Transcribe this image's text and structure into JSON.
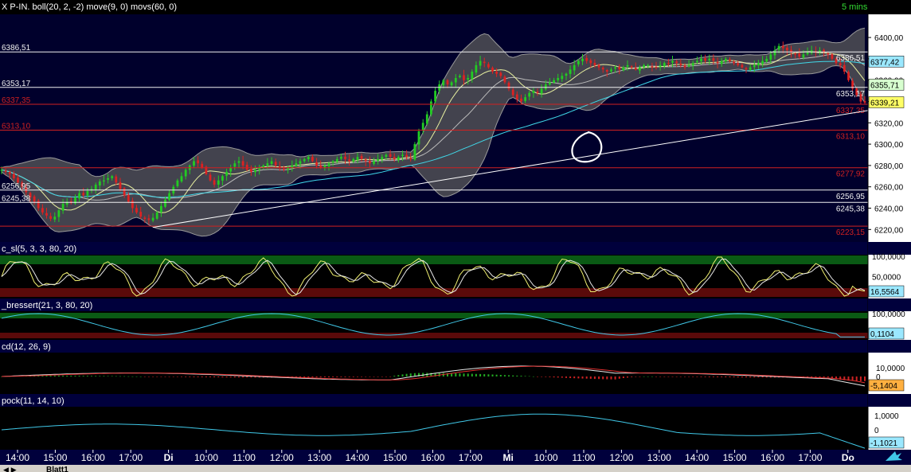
{
  "header": {
    "main_label": "X P-IN. boll(20, 2, -2) move(9, 0) movs(60, 0)",
    "timeframe": "5 mins"
  },
  "panes": {
    "stoch_label": "c_sl(5, 3, 3, 80, 20)",
    "bressert_label": "_bressert(21, 3, 80, 20)",
    "macd_label": "cd(12, 26, 9)",
    "coppock_label": "pock(11, 14, 10)"
  },
  "chart_data": [
    {
      "type": "candlestick",
      "title": "X P-IN. boll(20, 2, -2) move(9, 0) movs(60, 0)",
      "ylim": [
        6215,
        6412
      ],
      "yticks": [
        "6400,00",
        "6380,00",
        "6360,00",
        "6340,00",
        "6320,00",
        "6300,00",
        "6280,00",
        "6260,00",
        "6240,00",
        "6220,00"
      ],
      "grid": false,
      "x_tick_labels": [
        "14:00",
        "15:00",
        "16:00",
        "17:00",
        "Di",
        "10:00",
        "11:00",
        "12:00",
        "13:00",
        "14:00",
        "15:00",
        "16:00",
        "17:00",
        "Mi",
        "10:00",
        "11:00",
        "12:00",
        "13:00",
        "14:00",
        "15:00",
        "16:00",
        "17:00",
        "Do"
      ],
      "price_badges": [
        {
          "label": "6377,42",
          "value": 6377.42,
          "color": "#9be8ff"
        },
        {
          "label": "6355,71",
          "value": 6355.71,
          "color": "#d7ffcf"
        },
        {
          "label": "6339,21",
          "value": 6339.21,
          "color": "#ffff66"
        }
      ],
      "horizontal_lines": [
        {
          "value": 6386.51,
          "color": "#f0f0f0",
          "left_label": "6386,51",
          "right_label": "6386,51"
        },
        {
          "value": 6353.17,
          "color": "#f0f0f0",
          "left_label": "6353,17",
          "right_label": "6353,17"
        },
        {
          "value": 6337.35,
          "color": "#d02020",
          "left_label": "6337,35",
          "right_label": "6337,35"
        },
        {
          "value": 6313.1,
          "color": "#d02020",
          "left_label": "6313,10",
          "right_label": "6313,10"
        },
        {
          "value": 6277.92,
          "color": "#d02020",
          "left_label": "",
          "right_label": "6277,92"
        },
        {
          "value": 6256.95,
          "color": "#f0f0f0",
          "left_label": "6256,95",
          "right_label": "6256,95"
        },
        {
          "value": 6245.38,
          "color": "#f0f0f0",
          "left_label": "6245,38",
          "right_label": "6245,38"
        },
        {
          "value": 6223.15,
          "color": "#d02020",
          "left_label": "",
          "right_label": "6223,15"
        }
      ],
      "trendline": {
        "from": {
          "bar": 37,
          "value": 6222
        },
        "to": {
          "bar": 222,
          "value": 6338
        }
      },
      "series": [
        {
          "name": "close",
          "values": [
            6276,
            6274,
            6272,
            6268,
            6264,
            6260,
            6255,
            6250,
            6246,
            6240,
            6236,
            6233,
            6230,
            6232,
            6238,
            6244,
            6246,
            6245,
            6250,
            6254,
            6252,
            6256,
            6258,
            6262,
            6265,
            6266,
            6268,
            6270,
            6264,
            6258,
            6252,
            6246,
            6240,
            6236,
            6232,
            6230,
            6229,
            6231,
            6236,
            6242,
            6248,
            6254,
            6260,
            6266,
            6270,
            6276,
            6280,
            6284,
            6282,
            6278,
            6272,
            6266,
            6262,
            6266,
            6270,
            6274,
            6278,
            6282,
            6284,
            6280,
            6276,
            6274,
            6276,
            6278,
            6280,
            6282,
            6284,
            6280,
            6278,
            6276,
            6278,
            6280,
            6282,
            6284,
            6286,
            6288,
            6284,
            6280,
            6278,
            6280,
            6282,
            6284,
            6286,
            6288,
            6286,
            6284,
            6286,
            6288,
            6286,
            6284,
            6282,
            6284,
            6286,
            6288,
            6290,
            6288,
            6286,
            6288,
            6290,
            6288,
            6286,
            6300,
            6312,
            6320,
            6328,
            6340,
            6350,
            6356,
            6360,
            6356,
            6358,
            6362,
            6364,
            6360,
            6362,
            6368,
            6374,
            6378,
            6376,
            6372,
            6368,
            6366,
            6364,
            6358,
            6352,
            6346,
            6342,
            6340,
            6344,
            6348,
            6350,
            6348,
            6352,
            6356,
            6358,
            6360,
            6362,
            6364,
            6366,
            6370,
            6374,
            6378,
            6380,
            6378,
            6376,
            6374,
            6372,
            6370,
            6368,
            6370,
            6372,
            6370,
            6372,
            6374,
            6372,
            6370,
            6372,
            6374,
            6374,
            6372,
            6372,
            6374,
            6376,
            6376,
            6378,
            6376,
            6374,
            6372,
            6374,
            6376,
            6378,
            6380,
            6378,
            6380,
            6378,
            6376,
            6378,
            6380,
            6378,
            6376,
            6374,
            6372,
            6370,
            6372,
            6374,
            6376,
            6378,
            6380,
            6384,
            6388,
            6392,
            6390,
            6388,
            6386,
            6384,
            6382,
            6384,
            6386,
            6388,
            6386,
            6388,
            6386,
            6384,
            6380,
            6376,
            6374,
            6368,
            6360,
            6352,
            6346,
            6340,
            6339
          ]
        }
      ]
    },
    {
      "type": "line",
      "title": "c_sl(5, 3, 3, 80, 20)",
      "ylim": [
        0,
        100
      ],
      "yticks": [
        "100,0000",
        "50,0000"
      ],
      "zones": {
        "overbought": 80,
        "oversold": 20
      },
      "last_value_label": "16,5564"
    },
    {
      "type": "line",
      "title": "_bressert(21, 3, 80, 20)",
      "ylim": [
        0,
        100
      ],
      "yticks": [
        "100,0000"
      ],
      "zones": {
        "overbought": 80,
        "oversold": 20
      },
      "last_value_label": "0,1104"
    },
    {
      "type": "bar",
      "title": "cd(12, 26, 9)",
      "ylim": [
        -20,
        20
      ],
      "yticks": [
        "10,0000",
        "0"
      ],
      "last_value_label": "-5,1404"
    },
    {
      "type": "line",
      "title": "pock(11, 14, 10)",
      "ylim": [
        -1.5,
        1.5
      ],
      "yticks": [
        "1,0000",
        "0"
      ],
      "last_value_label": "-1,1021"
    }
  ],
  "bottom_tab": "Blatt1"
}
